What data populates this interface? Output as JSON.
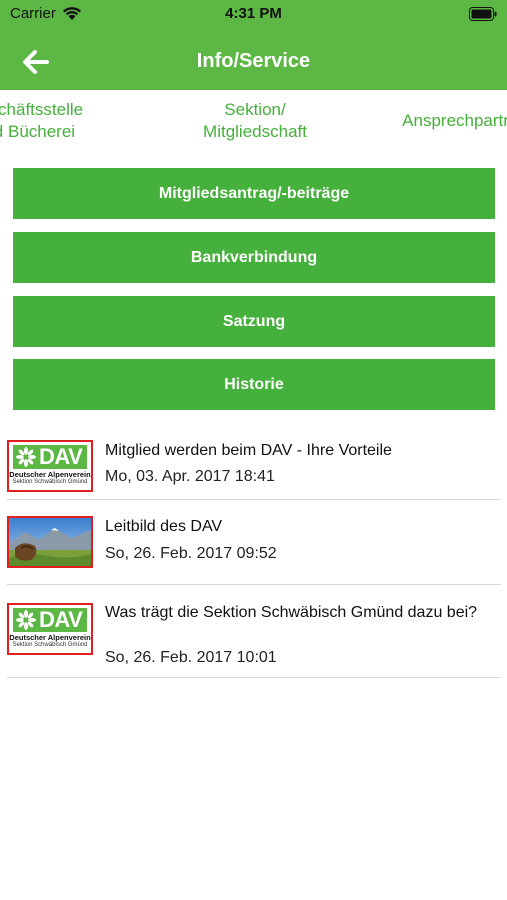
{
  "status": {
    "carrier": "Carrier",
    "time": "4:31 PM"
  },
  "header": {
    "title": "Info/Service",
    "back_icon": "arrow-left-icon"
  },
  "tabs": [
    {
      "line1": "Geschäftsstelle",
      "line2": "und Bücherei"
    },
    {
      "line1": "Sektion/",
      "line2": "Mitgliedschaft"
    },
    {
      "line1": "Ansprechpartner",
      "line2": ""
    }
  ],
  "menu": [
    {
      "label": "Mitgliedsantrag/-beiträge"
    },
    {
      "label": "Bankverbindung"
    },
    {
      "label": "Satzung"
    },
    {
      "label": "Historie"
    }
  ],
  "news": [
    {
      "title": "Mitglied werden beim DAV - Ihre Vorteile",
      "date": "Mo, 03. Apr. 2017 18:41",
      "thumb": "dav-logo"
    },
    {
      "title": "Leitbild des DAV",
      "date": "So, 26. Feb. 2017 09:52",
      "thumb": "mountain-photo"
    },
    {
      "title": "Was trägt die Sektion Schwäbisch Gmünd dazu bei?",
      "date": "So, 26. Feb. 2017 10:01",
      "thumb": "dav-logo"
    }
  ],
  "logo": {
    "word": "DAV",
    "line1": "Deutscher Alpenverein",
    "line2": "Sektion Schwäbisch Gmünd"
  },
  "colors": {
    "primary": "#45b03b",
    "header": "#5db745",
    "thumb_border": "#e02020",
    "divider": "#d9d9d9"
  }
}
